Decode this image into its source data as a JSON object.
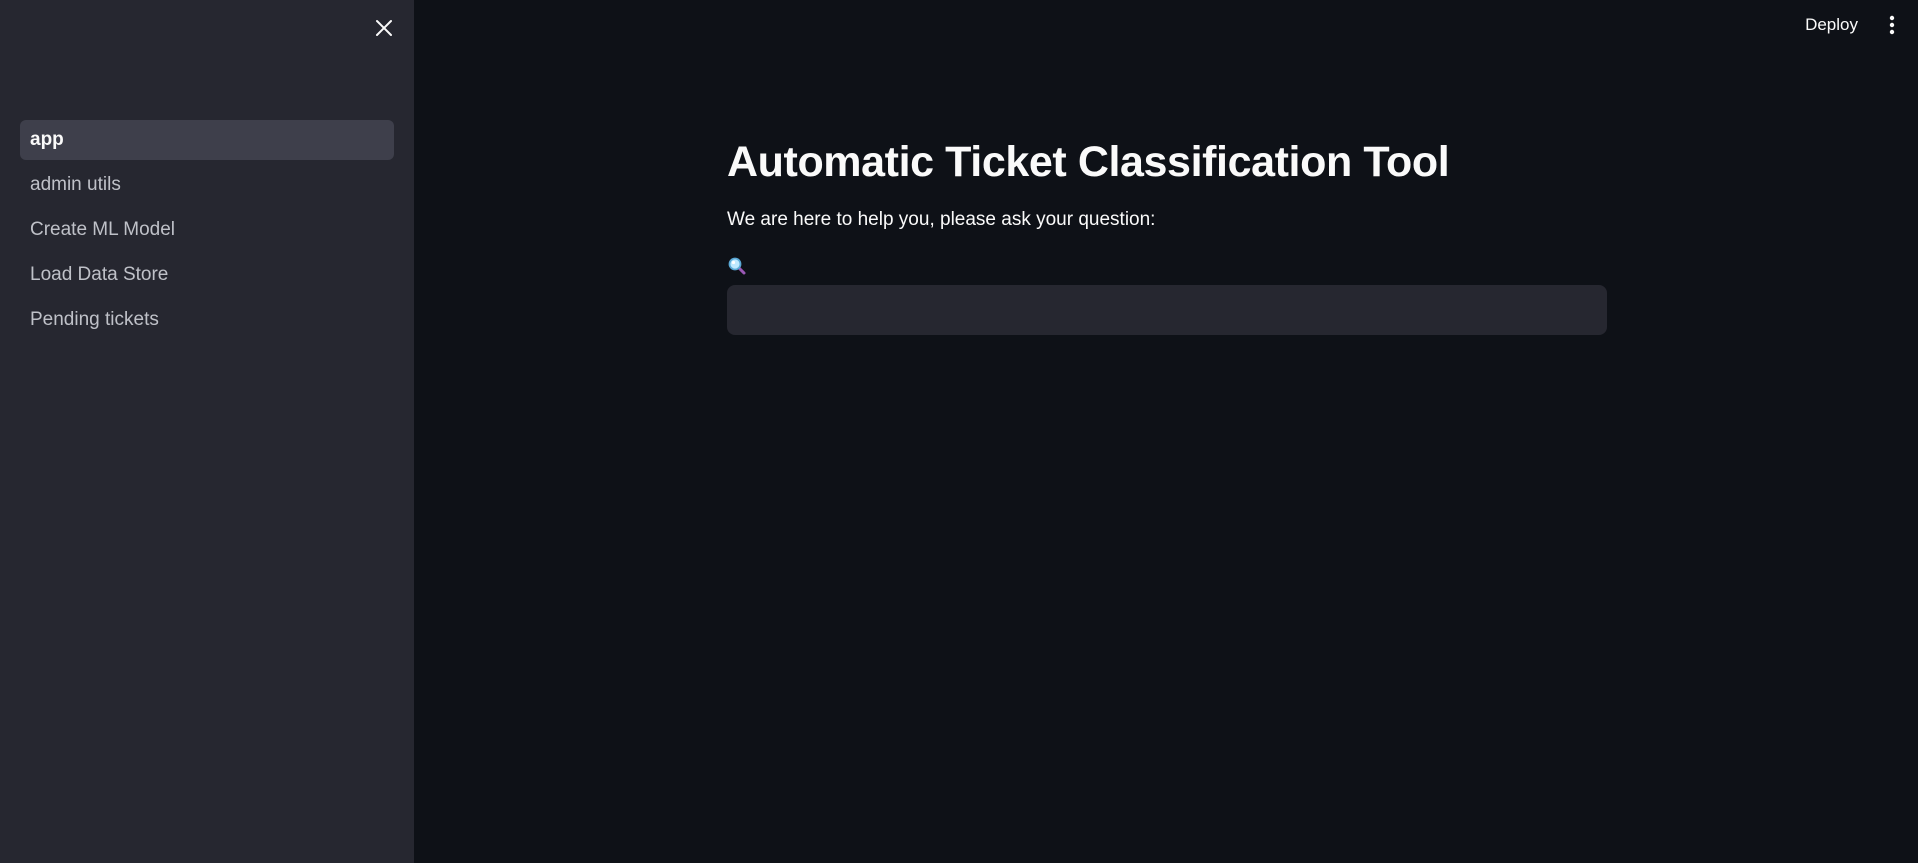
{
  "sidebar": {
    "items": [
      {
        "label": "app",
        "active": true
      },
      {
        "label": "admin utils",
        "active": false
      },
      {
        "label": "Create ML Model",
        "active": false
      },
      {
        "label": "Load Data Store",
        "active": false
      },
      {
        "label": "Pending tickets",
        "active": false
      }
    ]
  },
  "header": {
    "deploy_label": "Deploy"
  },
  "main": {
    "title": "Automatic Ticket Classification Tool",
    "subtitle": "We are here to help you, please ask your question:",
    "input_label_icon": "magnifying-glass-emoji",
    "input_value": "",
    "input_placeholder": ""
  },
  "colors": {
    "background": "#0e1117",
    "sidebar": "#262730",
    "active_item": "#3e3f4b",
    "text": "#fafafa"
  }
}
